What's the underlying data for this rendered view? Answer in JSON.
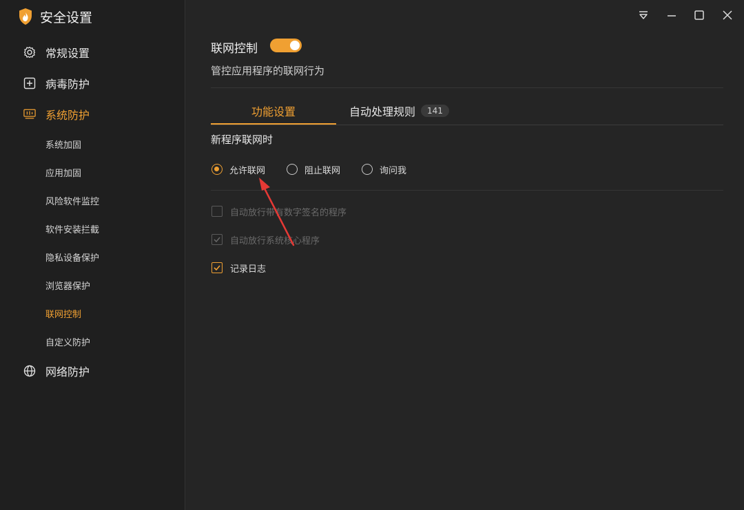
{
  "app": {
    "title": "安全设置",
    "logo_icon": "shield-flame-icon"
  },
  "sidebar": {
    "groups": [
      {
        "label": "常规设置",
        "icon": "gear-icon"
      },
      {
        "label": "病毒防护",
        "icon": "plus-square-icon"
      },
      {
        "label": "系统防护",
        "icon": "system-monitor-icon",
        "active": true
      },
      {
        "label": "网络防护",
        "icon": "globe-icon"
      }
    ],
    "sub_items": [
      "系统加固",
      "应用加固",
      "风险软件监控",
      "软件安装拦截",
      "隐私设备保护",
      "浏览器保护",
      "联网控制",
      "自定义防护"
    ],
    "active_sub": "联网控制"
  },
  "main": {
    "section_title": "联网控制",
    "toggle_on": true,
    "section_desc": "管控应用程序的联网行为",
    "tabs": [
      {
        "label": "功能设置",
        "active": true
      },
      {
        "label": "自动处理规则",
        "badge": "141"
      }
    ],
    "subheading": "新程序联网时",
    "radios": [
      {
        "label": "允许联网",
        "checked": true
      },
      {
        "label": "阻止联网",
        "checked": false
      },
      {
        "label": "询问我",
        "checked": false
      }
    ],
    "checkboxes": [
      {
        "label": "自动放行带有数字签名的程序",
        "checked": false,
        "enabled": false
      },
      {
        "label": "自动放行系统核心程序",
        "checked": true,
        "enabled": false
      },
      {
        "label": "记录日志",
        "checked": true,
        "enabled": true
      }
    ]
  },
  "colors": {
    "accent": "#f0a032",
    "background": "#252525",
    "sidebar": "#1f1f1f",
    "annotation_arrow": "#e53935"
  }
}
